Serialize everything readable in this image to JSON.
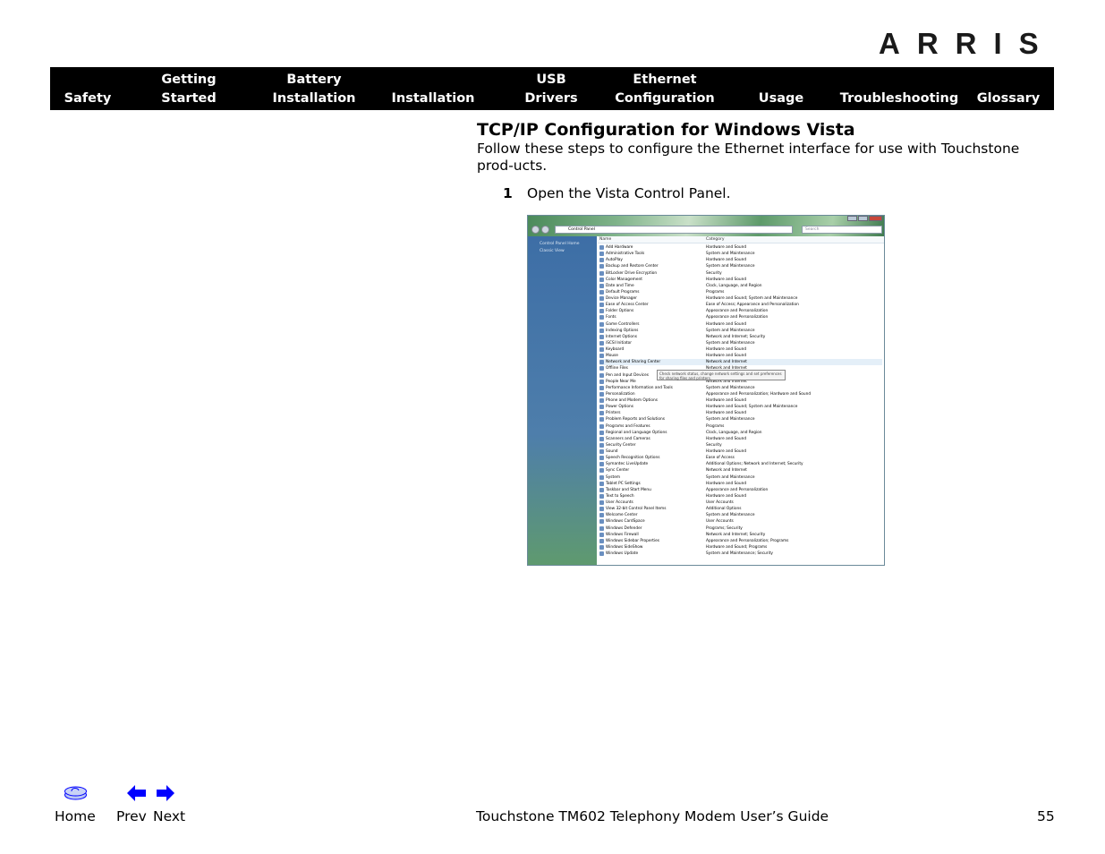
{
  "logo": "ARRIS",
  "nav": [
    {
      "line1": "",
      "line2": "Safety"
    },
    {
      "line1": "Getting",
      "line2": "Started"
    },
    {
      "line1": "Battery",
      "line2": "Installation"
    },
    {
      "line1": "",
      "line2": "Installation"
    },
    {
      "line1": "USB",
      "line2": "Drivers"
    },
    {
      "line1": "Ethernet",
      "line2": "Configuration"
    },
    {
      "line1": "",
      "line2": "Usage"
    },
    {
      "line1": "",
      "line2": "Troubleshooting"
    },
    {
      "line1": "",
      "line2": "Glossary"
    }
  ],
  "section": {
    "title": "TCP/IP Configuration for Windows Vista",
    "intro": "Follow these steps to configure the Ethernet interface for use with Touchstone prod-ucts.",
    "step_number": "1",
    "step_text": "Open the Vista Control Panel."
  },
  "screenshot": {
    "address": "Control Panel",
    "search_placeholder": "Search",
    "sidebar": [
      "Control Panel Home",
      "Classic View"
    ],
    "col_name": "Name",
    "col_category": "Category",
    "selected": "Network and Sharing Center",
    "tooltip": "Check network status, change network settings and set preferences for sharing files and printers.",
    "items": [
      [
        "Add Hardware",
        "Hardware and Sound"
      ],
      [
        "Administrative Tools",
        "System and Maintenance"
      ],
      [
        "AutoPlay",
        "Hardware and Sound"
      ],
      [
        "Backup and Restore Center",
        "System and Maintenance"
      ],
      [
        "BitLocker Drive Encryption",
        "Security"
      ],
      [
        "Color Management",
        "Hardware and Sound"
      ],
      [
        "Date and Time",
        "Clock, Language, and Region"
      ],
      [
        "Default Programs",
        "Programs"
      ],
      [
        "Device Manager",
        "Hardware and Sound; System and Maintenance"
      ],
      [
        "Ease of Access Center",
        "Ease of Access; Appearance and Personalization"
      ],
      [
        "Folder Options",
        "Appearance and Personalization"
      ],
      [
        "Fonts",
        "Appearance and Personalization"
      ],
      [
        "Game Controllers",
        "Hardware and Sound"
      ],
      [
        "Indexing Options",
        "System and Maintenance"
      ],
      [
        "Internet Options",
        "Network and Internet; Security"
      ],
      [
        "iSCSI Initiator",
        "System and Maintenance"
      ],
      [
        "Keyboard",
        "Hardware and Sound"
      ],
      [
        "Mouse",
        "Hardware and Sound"
      ],
      [
        "Network and Sharing Center",
        "Network and Internet"
      ],
      [
        "Offline Files",
        "Network and Internet"
      ],
      [
        "Pen and Input Devices",
        ""
      ],
      [
        "People Near Me",
        "Network and Internet"
      ],
      [
        "Performance Information and Tools",
        "System and Maintenance"
      ],
      [
        "Personalization",
        "Appearance and Personalization; Hardware and Sound"
      ],
      [
        "Phone and Modem Options",
        "Hardware and Sound"
      ],
      [
        "Power Options",
        "Hardware and Sound; System and Maintenance"
      ],
      [
        "Printers",
        "Hardware and Sound"
      ],
      [
        "Problem Reports and Solutions",
        "System and Maintenance"
      ],
      [
        "Programs and Features",
        "Programs"
      ],
      [
        "Regional and Language Options",
        "Clock, Language, and Region"
      ],
      [
        "Scanners and Cameras",
        "Hardware and Sound"
      ],
      [
        "Security Center",
        "Security"
      ],
      [
        "Sound",
        "Hardware and Sound"
      ],
      [
        "Speech Recognition Options",
        "Ease of Access"
      ],
      [
        "Symantec LiveUpdate",
        "Additional Options; Network and Internet; Security"
      ],
      [
        "Sync Center",
        "Network and Internet"
      ],
      [
        "System",
        "System and Maintenance"
      ],
      [
        "Tablet PC Settings",
        "Hardware and Sound"
      ],
      [
        "Taskbar and Start Menu",
        "Appearance and Personalization"
      ],
      [
        "Text to Speech",
        "Hardware and Sound"
      ],
      [
        "User Accounts",
        "User Accounts"
      ],
      [
        "View 32-bit Control Panel Items",
        "Additional Options"
      ],
      [
        "Welcome Center",
        "System and Maintenance"
      ],
      [
        "Windows CardSpace",
        "User Accounts"
      ],
      [
        "Windows Defender",
        "Programs; Security"
      ],
      [
        "Windows Firewall",
        "Network and Internet; Security"
      ],
      [
        "Windows Sidebar Properties",
        "Appearance and Personalization; Programs"
      ],
      [
        "Windows SideShow",
        "Hardware and Sound; Programs"
      ],
      [
        "Windows Update",
        "System and Maintenance; Security"
      ]
    ]
  },
  "footer": {
    "home": "Home",
    "prev": "Prev",
    "next": "Next",
    "guide_title": "Touchstone TM602 Telephony Modem User’s Guide",
    "page": "55",
    "icon_color": "#0000ff"
  }
}
